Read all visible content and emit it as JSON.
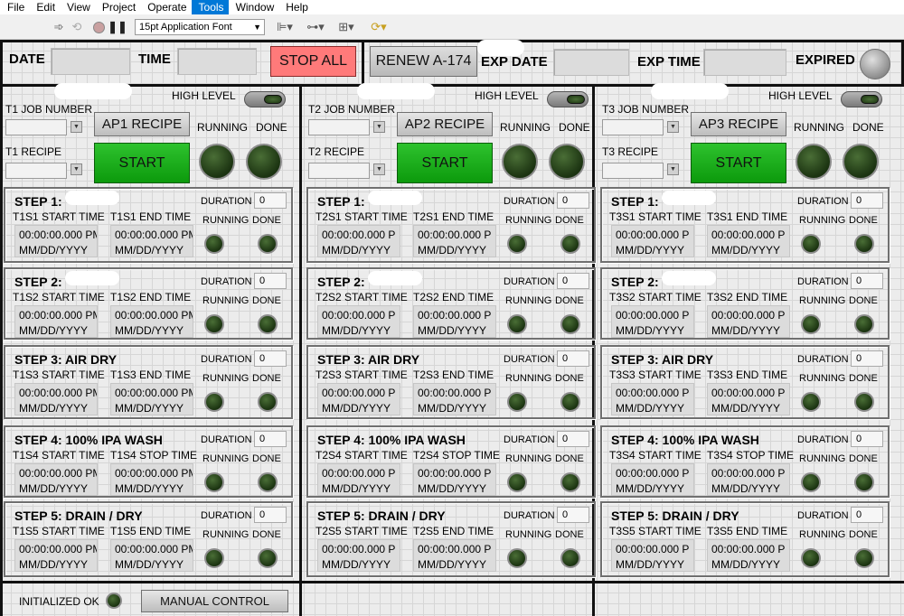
{
  "menu": [
    "File",
    "Edit",
    "View",
    "Project",
    "Operate",
    "Tools",
    "Window",
    "Help"
  ],
  "menu_active": "Tools",
  "toolbar": {
    "font": "15pt Application Font"
  },
  "top": {
    "date_label": "DATE",
    "time_label": "TIME",
    "stop_all": "STOP ALL",
    "renew": "RENEW A-174",
    "exp_date": "EXP DATE",
    "exp_time": "EXP TIME",
    "expired": "EXPIRED"
  },
  "bottom": {
    "initialized": "INITIALIZED OK",
    "manual": "MANUAL CONTROL"
  },
  "common": {
    "high_level": "HIGH LEVEL",
    "running": "RUNNING",
    "done": "DONE",
    "start": "START",
    "duration": "DURATION",
    "dur_val": "0",
    "dt1_pm": "00:00:00.000 PM",
    "dt1_p": "00:00:00.000 P",
    "dt2": "MM/DD/YYYY"
  },
  "tanks": [
    {
      "job": "T1 JOB NUMBER",
      "recipe": "T1 RECIPE",
      "ap": "AP1 RECIPE",
      "steps": [
        {
          "title": "STEP 1:",
          "start": "T1S1 START TIME",
          "end": "T1S1 END TIME"
        },
        {
          "title": "STEP 2:",
          "start": "T1S2 START TIME",
          "end": "T1S2 END TIME"
        },
        {
          "title": "STEP 3: AIR DRY",
          "start": "T1S3 START TIME",
          "end": "T1S3 END TIME"
        },
        {
          "title": "STEP 4: 100% IPA WASH",
          "start": "T1S4 START TIME",
          "end": "T1S4 STOP TIME"
        },
        {
          "title": "STEP 5: DRAIN / DRY",
          "start": "T1S5 START TIME",
          "end": "T1S5 END TIME"
        }
      ]
    },
    {
      "job": "T2 JOB NUMBER",
      "recipe": "T2 RECIPE",
      "ap": "AP2 RECIPE",
      "steps": [
        {
          "title": "STEP 1:",
          "start": "T2S1 START TIME",
          "end": "T2S1 END TIME"
        },
        {
          "title": "STEP 2:",
          "start": "T2S2 START TIME",
          "end": "T2S2 END TIME"
        },
        {
          "title": "STEP 3: AIR DRY",
          "start": "T2S3 START TIME",
          "end": "T2S3 END TIME"
        },
        {
          "title": "STEP 4: 100% IPA WASH",
          "start": "T2S4 START TIME",
          "end": "T2S4 STOP TIME"
        },
        {
          "title": "STEP 5: DRAIN / DRY",
          "start": "T2S5 START TIME",
          "end": "T2S5 END TIME"
        }
      ]
    },
    {
      "job": "T3 JOB NUMBER",
      "recipe": "T3 RECIPE",
      "ap": "AP3 RECIPE",
      "steps": [
        {
          "title": "STEP 1:",
          "start": "T3S1 START TIME",
          "end": "T3S1 END TIME"
        },
        {
          "title": "STEP 2:",
          "start": "T3S2 START TIME",
          "end": "T3S2 END TIME"
        },
        {
          "title": "STEP 3: AIR DRY",
          "start": "T3S3 START TIME",
          "end": "T3S3 END TIME"
        },
        {
          "title": "STEP 4: 100% IPA WASH",
          "start": "T3S4 START TIME",
          "end": "T3S4 STOP TIME"
        },
        {
          "title": "STEP 5: DRAIN / DRY",
          "start": "T3S5 START TIME",
          "end": "T3S5 END TIME"
        }
      ]
    }
  ]
}
